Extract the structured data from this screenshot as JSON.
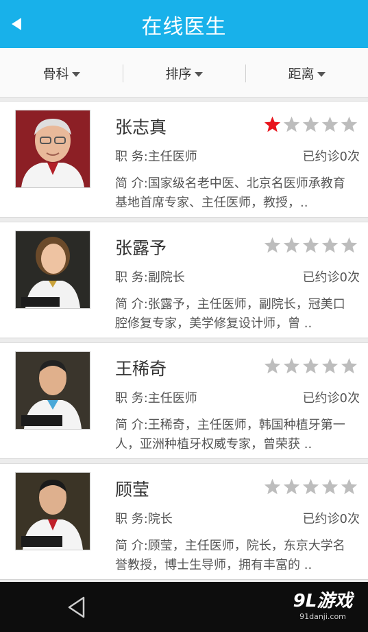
{
  "header": {
    "title": "在线医生"
  },
  "filters": [
    {
      "label": "骨科"
    },
    {
      "label": "排序"
    },
    {
      "label": "距离"
    }
  ],
  "doctors": [
    {
      "name": "张志真",
      "role": "职  务:主任医师",
      "visits": "已约诊0次",
      "bio": "简  介:国家级名老中医、北京名医师承教育基地首席专家、主任医师，教授，..",
      "rating": 1
    },
    {
      "name": "张露予",
      "role": "职  务:副院长",
      "visits": "已约诊0次",
      "bio": "简  介:张露予，主任医师，副院长，冠美口腔修复专家，美学修复设计师，曾 ..",
      "rating": 0
    },
    {
      "name": "王稀奇",
      "role": "职  务:主任医师",
      "visits": "已约诊0次",
      "bio": "简  介:王稀奇，主任医师，韩国种植牙第一人，亚洲种植牙权威专家，曾荣获 ..",
      "rating": 0
    },
    {
      "name": "顾莹",
      "role": "职  务:院长",
      "visits": "已约诊0次",
      "bio": "简  介:顾莹，主任医师，院长，东京大学名誉教授，博士生导师，拥有丰富的 ..",
      "rating": 0
    }
  ],
  "rating_max": 5,
  "footer": {
    "logo": "9L游戏",
    "logo_sub": "91danji.com"
  },
  "colors": {
    "header": "#18b1ea",
    "star_on": "#e8141c",
    "star_off": "#bdbdbd",
    "navbar": "#0d0d0d"
  },
  "icons": {
    "back": "back-arrow-icon",
    "nav_back": "nav-back-icon",
    "star": "star-icon",
    "dropdown": "caret-down-icon"
  }
}
